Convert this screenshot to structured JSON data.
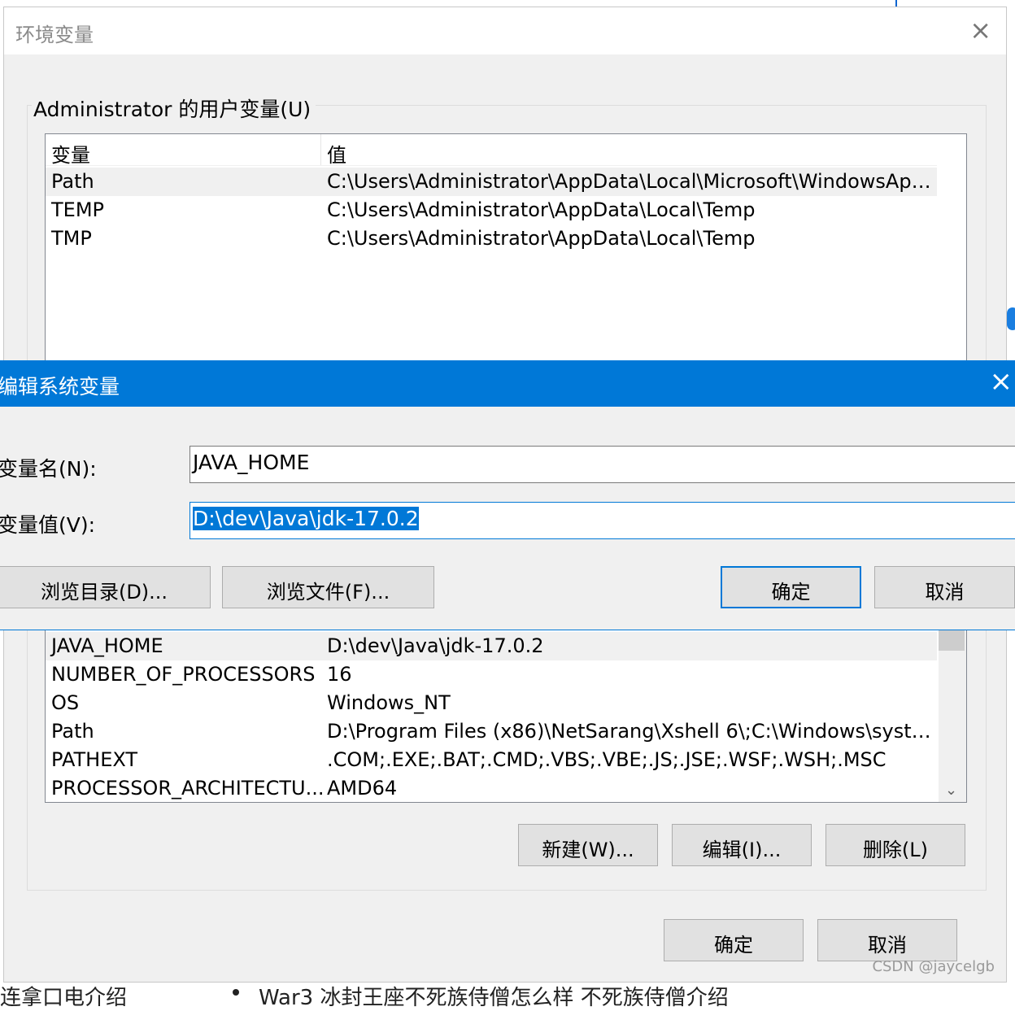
{
  "background": {
    "left_text": "连拿口电介绍",
    "right_text": "War3 冰封王座不死族侍僧怎么样 不死族侍僧介绍"
  },
  "env_window": {
    "title": "环境变量",
    "close_icon": "×",
    "user_group_label": "Administrator 的用户变量(U)",
    "user_vars": {
      "header_name": "变量",
      "header_value": "值",
      "rows": [
        {
          "name": "Path",
          "value": "C:\\Users\\Administrator\\AppData\\Local\\Microsoft\\WindowsApps;"
        },
        {
          "name": "TEMP",
          "value": "C:\\Users\\Administrator\\AppData\\Local\\Temp"
        },
        {
          "name": "TMP",
          "value": "C:\\Users\\Administrator\\AppData\\Local\\Temp"
        }
      ]
    },
    "system_vars": {
      "rows": [
        {
          "name": "JAVA_HOME",
          "value": "D:\\dev\\Java\\jdk-17.0.2"
        },
        {
          "name": "NUMBER_OF_PROCESSORS",
          "value": "16"
        },
        {
          "name": "OS",
          "value": "Windows_NT"
        },
        {
          "name": "Path",
          "value": "D:\\Program Files (x86)\\NetSarang\\Xshell 6\\;C:\\Windows\\system..."
        },
        {
          "name": "PATHEXT",
          "value": ".COM;.EXE;.BAT;.CMD;.VBS;.VBE;.JS;.JSE;.WSF;.WSH;.MSC"
        },
        {
          "name": "PROCESSOR_ARCHITECTU...",
          "value": "AMD64"
        }
      ],
      "scroll_down_icon": "⌄"
    },
    "buttons": {
      "new": "新建(W)...",
      "edit": "编辑(I)...",
      "delete": "删除(L)",
      "ok": "确定",
      "cancel": "取消"
    },
    "watermark": "CSDN @jaycelgb"
  },
  "edit_dialog": {
    "title": "编辑系统变量",
    "close_icon": "×",
    "name_label": "变量名(N):",
    "name_value": "JAVA_HOME",
    "value_label": "变量值(V):",
    "value_value": "D:\\dev\\Java\\jdk-17.0.2",
    "buttons": {
      "browse_dir": "浏览目录(D)...",
      "browse_file": "浏览文件(F)...",
      "ok": "确定",
      "cancel": "取消"
    }
  },
  "colors": {
    "accent": "#0078d7",
    "window_bg": "#f0f0f0"
  }
}
